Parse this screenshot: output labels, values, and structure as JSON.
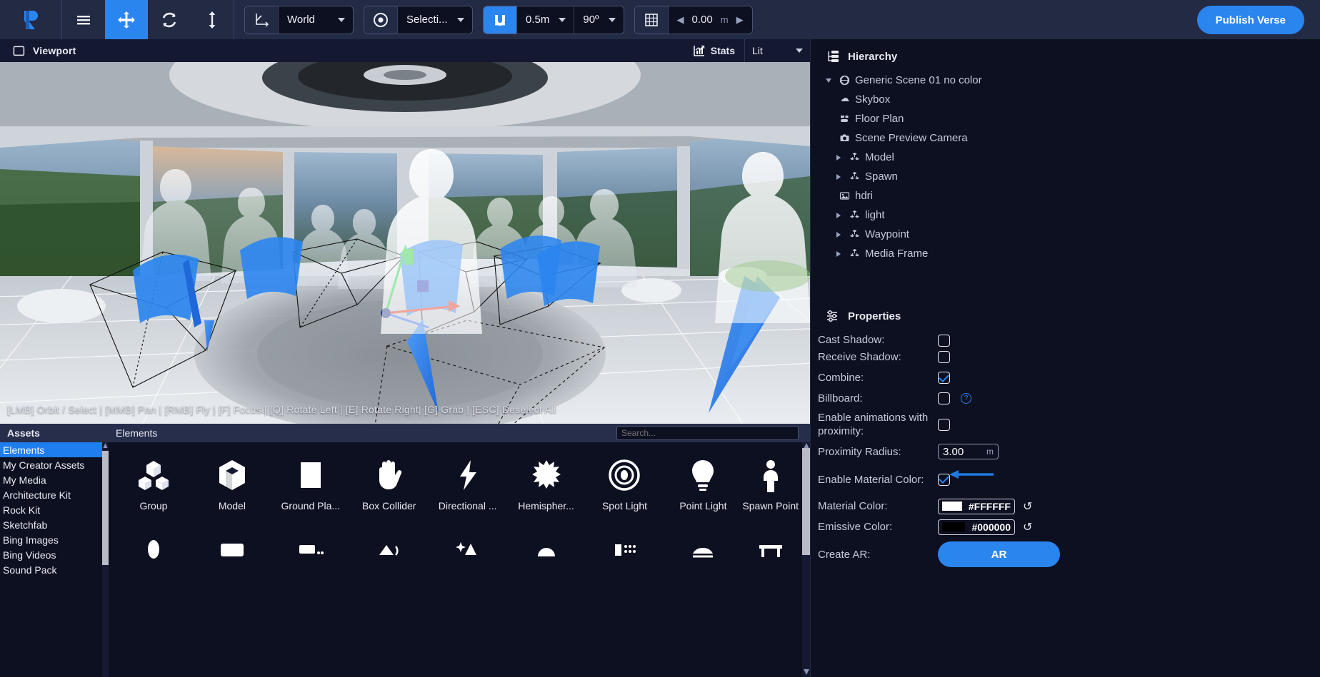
{
  "toolbar": {
    "logo_icon": "verse-logo-icon",
    "menu_icon": "hamburger-menu-icon",
    "tools": [
      {
        "name": "move-tool",
        "icon": "move-arrows-icon",
        "active": true
      },
      {
        "name": "rotate-tool",
        "icon": "rotate-icon",
        "active": false
      },
      {
        "name": "scale-tool",
        "icon": "vertical-arrows-icon",
        "active": false
      }
    ],
    "coordinate_space": {
      "icon": "axis-icon",
      "value": "World"
    },
    "pivot_mode": {
      "icon": "target-icon",
      "value": "Selecti..."
    },
    "snap": {
      "icon": "magnet-icon",
      "grid_value": "0.5m",
      "angle_value": "90º"
    },
    "grid": {
      "icon": "grid-icon",
      "value": "0.00",
      "unit": "m",
      "left_arrow": "◀",
      "right_arrow": "▶"
    },
    "publish_label": "Publish Verse"
  },
  "viewport": {
    "panel_icon": "panel-icon",
    "title": "Viewport",
    "stats_icon": "stats-chart-icon",
    "stats_label": "Stats",
    "shading_mode": "Lit",
    "hint": "[LMB] Orbit / Select | [MMB] Pan | [RMB] Fly | [F] Focus | [Q] Rotate Left | [E] Rotate Right| [G] Grab | [ESC] Deselect All"
  },
  "assets": {
    "header": "Assets",
    "items": [
      {
        "label": "Elements",
        "selected": true
      },
      {
        "label": "My Creator Assets",
        "selected": false
      },
      {
        "label": "My Media",
        "selected": false
      },
      {
        "label": "Architecture Kit",
        "selected": false
      },
      {
        "label": "Rock Kit",
        "selected": false
      },
      {
        "label": "Sketchfab",
        "selected": false
      },
      {
        "label": "Bing Images",
        "selected": false
      },
      {
        "label": "Bing Videos",
        "selected": false
      },
      {
        "label": "Sound Pack",
        "selected": false
      }
    ]
  },
  "elements": {
    "header": "Elements",
    "search_placeholder": "Search...",
    "tiles": [
      {
        "label": "Group",
        "icon": "group-cubes-icon"
      },
      {
        "label": "Model",
        "icon": "cube-model-icon"
      },
      {
        "label": "Ground Pla...",
        "icon": "ground-plane-icon"
      },
      {
        "label": "Box Collider",
        "icon": "hand-collider-icon"
      },
      {
        "label": "Directional ...",
        "icon": "bolt-directional-light-icon"
      },
      {
        "label": "Hemispher...",
        "icon": "burst-hemisphere-light-icon"
      },
      {
        "label": "Spot Light",
        "icon": "spot-light-icon"
      },
      {
        "label": "Point Light",
        "icon": "point-light-bulb-icon"
      },
      {
        "label": "Spawn Point",
        "icon": "spawn-person-icon"
      }
    ]
  },
  "hierarchy": {
    "icon": "hierarchy-icon",
    "title": "Hierarchy",
    "nodes": [
      {
        "label": "Generic Scene 01 no color",
        "icon": "globe-icon",
        "indent": 0,
        "twisty": "open"
      },
      {
        "label": "Skybox",
        "icon": "cloud-icon",
        "indent": 1,
        "twisty": "none"
      },
      {
        "label": "Floor Plan",
        "icon": "floorplan-icon",
        "indent": 1,
        "twisty": "none"
      },
      {
        "label": "Scene Preview Camera",
        "icon": "camera-icon",
        "indent": 1,
        "twisty": "none"
      },
      {
        "label": "Model",
        "icon": "group-cubes-icon",
        "indent": 1,
        "twisty": "closed"
      },
      {
        "label": "Spawn",
        "icon": "group-cubes-icon",
        "indent": 1,
        "twisty": "closed"
      },
      {
        "label": "hdri",
        "icon": "image-icon",
        "indent": 1,
        "twisty": "none"
      },
      {
        "label": "light",
        "icon": "group-cubes-icon",
        "indent": 1,
        "twisty": "closed"
      },
      {
        "label": "Waypoint",
        "icon": "group-cubes-icon",
        "indent": 1,
        "twisty": "closed"
      },
      {
        "label": "Media Frame",
        "icon": "group-cubes-icon",
        "indent": 1,
        "twisty": "closed"
      }
    ]
  },
  "properties": {
    "icon": "sliders-icon",
    "title": "Properties",
    "rows": [
      {
        "label": "Cast Shadow:",
        "type": "checkbox",
        "checked": false
      },
      {
        "label": "Receive Shadow:",
        "type": "checkbox",
        "checked": false
      },
      {
        "label": "Combine:",
        "type": "checkbox",
        "checked": true
      },
      {
        "label": "Billboard:",
        "type": "checkbox",
        "checked": false,
        "help": "?"
      },
      {
        "label": "Enable animations with proximity:",
        "type": "checkbox",
        "checked": false
      },
      {
        "label": "Proximity Radius:",
        "type": "number",
        "value": "3.00",
        "unit": "m"
      },
      {
        "label": "Enable Material Color:",
        "type": "checkbox",
        "checked": true,
        "annotated": true
      },
      {
        "label": "Material Color:",
        "type": "color",
        "value": "#FFFFFF",
        "swatch": "#FFFFFF",
        "reset": "↺"
      },
      {
        "label": "Emissive Color:",
        "type": "color",
        "value": "#000000",
        "swatch": "#000000",
        "reset": "↺"
      },
      {
        "label": "Create AR:",
        "type": "button",
        "value": "AR"
      }
    ]
  },
  "colors": {
    "accent": "#2b85ef",
    "panel_bg": "#0d1020",
    "toolbar_bg": "#232a44",
    "header_bg": "#272e4c"
  }
}
